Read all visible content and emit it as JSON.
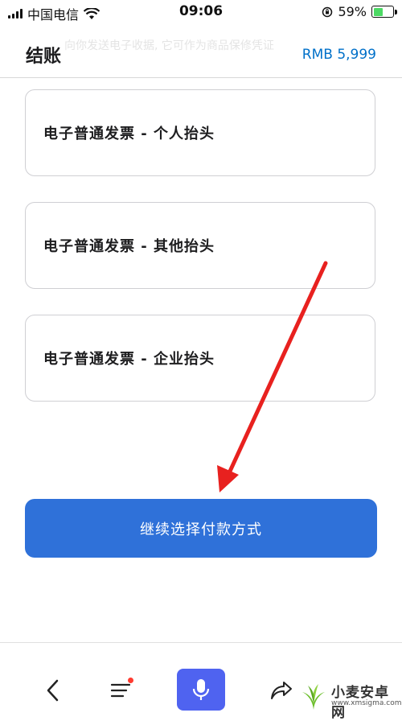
{
  "status_bar": {
    "carrier": "中国电信",
    "time": "09:06",
    "battery_percent_label": "59%",
    "battery_level": 0.59
  },
  "header": {
    "title": "结账",
    "total_price": "RMB 5,999",
    "ghost_note": "向你发送电子收据, 它可作为商品保修凭证"
  },
  "invoice_options": [
    {
      "label": "电子普通发票 - 个人抬头"
    },
    {
      "label": "电子普通发票 - 其他抬头"
    },
    {
      "label": "电子普通发票 - 企业抬头"
    }
  ],
  "continue_button": {
    "label": "继续选择付款方式"
  },
  "watermark": {
    "name": "小麦安卓网",
    "url": "www.xmsigma.com"
  },
  "colors": {
    "accent_blue": "#2f71d9",
    "price_blue": "#0070c9",
    "annotation_red": "#e8211f",
    "mic_blue": "#4f63f0"
  }
}
